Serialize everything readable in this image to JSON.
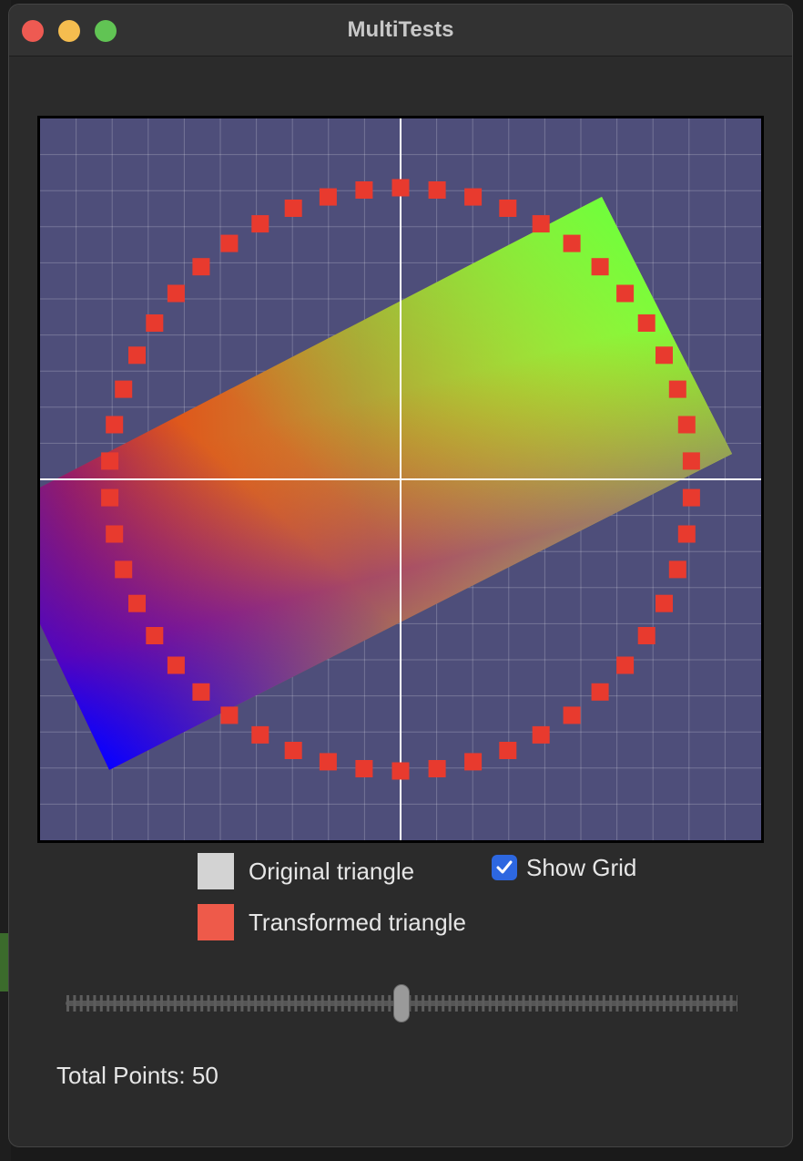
{
  "window": {
    "title": "MultiTests"
  },
  "legend": {
    "original_label": "Original triangle",
    "original_color": "#d3d3d3",
    "transformed_label": "Transformed triangle",
    "transformed_color": "#ee5a4a"
  },
  "show_grid": {
    "label": "Show Grid",
    "checked": true
  },
  "slider": {
    "value_fraction": 0.5
  },
  "status": {
    "total_points_text": "Total Points: 50",
    "total_points": 50
  },
  "colors": {
    "plot_background": "#4e4e7a",
    "point_color": "#e83a2e",
    "gradient_red": "#ff2a00",
    "gradient_green": "#6cff3c",
    "gradient_blue": "#0a00ff",
    "gradient_yellow": "#ffff30"
  }
}
